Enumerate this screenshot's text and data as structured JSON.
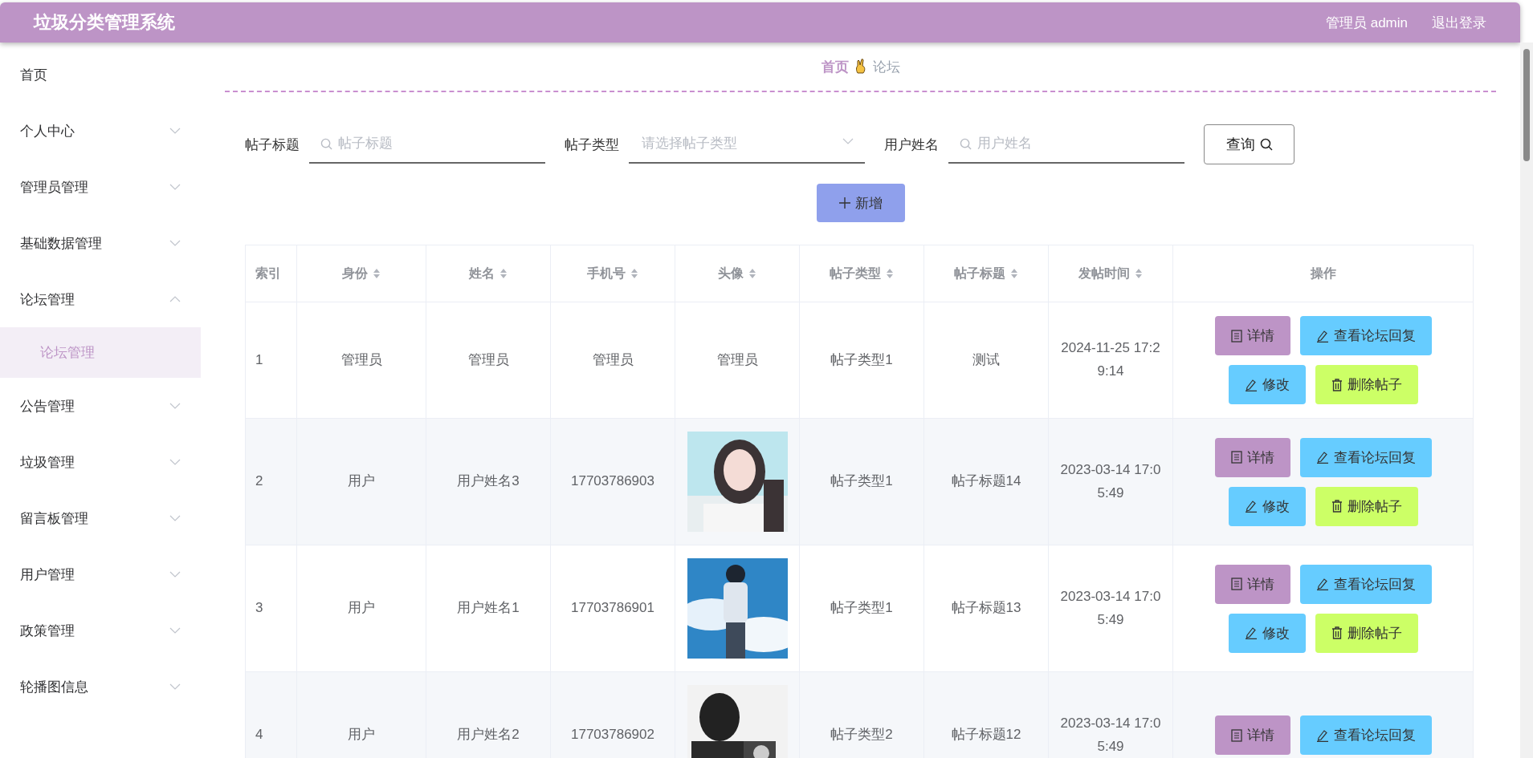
{
  "header": {
    "title": "垃圾分类管理系统",
    "user": "管理员 admin",
    "logout": "退出登录"
  },
  "sidebar": {
    "items": [
      {
        "label": "首页",
        "kind": "link"
      },
      {
        "label": "个人中心",
        "kind": "menu",
        "expanded": false
      },
      {
        "label": "管理员管理",
        "kind": "menu",
        "expanded": false
      },
      {
        "label": "基础数据管理",
        "kind": "menu",
        "expanded": false
      },
      {
        "label": "论坛管理",
        "kind": "menu",
        "expanded": true,
        "children": [
          {
            "label": "论坛管理",
            "selected": true
          }
        ]
      },
      {
        "label": "公告管理",
        "kind": "menu",
        "expanded": false
      },
      {
        "label": "垃圾管理",
        "kind": "menu",
        "expanded": false
      },
      {
        "label": "留言板管理",
        "kind": "menu",
        "expanded": false
      },
      {
        "label": "用户管理",
        "kind": "menu",
        "expanded": false
      },
      {
        "label": "政策管理",
        "kind": "menu",
        "expanded": false
      },
      {
        "label": "轮播图信息",
        "kind": "menu",
        "expanded": false
      }
    ]
  },
  "breadcrumb": [
    {
      "label": "首页",
      "selected": true
    },
    {
      "label": "论坛",
      "selected": false
    }
  ],
  "search": {
    "fields": [
      {
        "label": "帖子标题",
        "kind": "text",
        "placeholder": "帖子标题"
      },
      {
        "label": "帖子类型",
        "kind": "select",
        "placeholder": "请选择帖子类型"
      },
      {
        "label": "用户姓名",
        "kind": "text",
        "placeholder": "用户姓名"
      }
    ],
    "query_button": "查询",
    "add_button": "新增"
  },
  "table": {
    "columns": [
      {
        "label": "索引",
        "sortable": false
      },
      {
        "label": "身份",
        "sortable": true
      },
      {
        "label": "姓名",
        "sortable": true
      },
      {
        "label": "手机号",
        "sortable": true
      },
      {
        "label": "头像",
        "sortable": true
      },
      {
        "label": "帖子类型",
        "sortable": true
      },
      {
        "label": "帖子标题",
        "sortable": true
      },
      {
        "label": "发帖时间",
        "sortable": true
      },
      {
        "label": "操作",
        "sortable": false
      }
    ],
    "rows": [
      {
        "index": "1",
        "role": "管理员",
        "name": "管理员",
        "phone": "管理员",
        "avatar": {
          "kind": "text",
          "text": "管理员"
        },
        "type": "帖子类型1",
        "title": "测试",
        "time": "2024-11-25 17:29:14",
        "actions": [
          {
            "label": "详情",
            "kind": "detail"
          },
          {
            "label": "查看论坛回复",
            "kind": "replies"
          },
          {
            "label": "修改",
            "kind": "edit"
          },
          {
            "label": "删除帖子",
            "kind": "delete"
          }
        ]
      },
      {
        "index": "2",
        "role": "用户",
        "name": "用户姓名3",
        "phone": "17703786903",
        "avatar": {
          "kind": "picture"
        },
        "type": "帖子类型1",
        "title": "帖子标题14",
        "time": "2023-03-14 17:05:49",
        "actions": [
          {
            "label": "详情",
            "kind": "detail"
          },
          {
            "label": "查看论坛回复",
            "kind": "replies"
          },
          {
            "label": "修改",
            "kind": "edit"
          },
          {
            "label": "删除帖子",
            "kind": "delete"
          }
        ]
      },
      {
        "index": "3",
        "role": "用户",
        "name": "用户姓名1",
        "phone": "17703786901",
        "avatar": {
          "kind": "picture"
        },
        "type": "帖子类型1",
        "title": "帖子标题13",
        "time": "2023-03-14 17:05:49",
        "actions": [
          {
            "label": "详情",
            "kind": "detail"
          },
          {
            "label": "查看论坛回复",
            "kind": "replies"
          },
          {
            "label": "修改",
            "kind": "edit"
          },
          {
            "label": "删除帖子",
            "kind": "delete"
          }
        ]
      },
      {
        "index": "4",
        "role": "用户",
        "name": "用户姓名2",
        "phone": "17703786902",
        "avatar": {
          "kind": "picture"
        },
        "type": "帖子类型2",
        "title": "帖子标题12",
        "time": "2023-03-14 17:05:49",
        "actions": [
          {
            "label": "详情",
            "kind": "detail"
          },
          {
            "label": "查看论坛回复",
            "kind": "replies"
          }
        ]
      }
    ]
  }
}
